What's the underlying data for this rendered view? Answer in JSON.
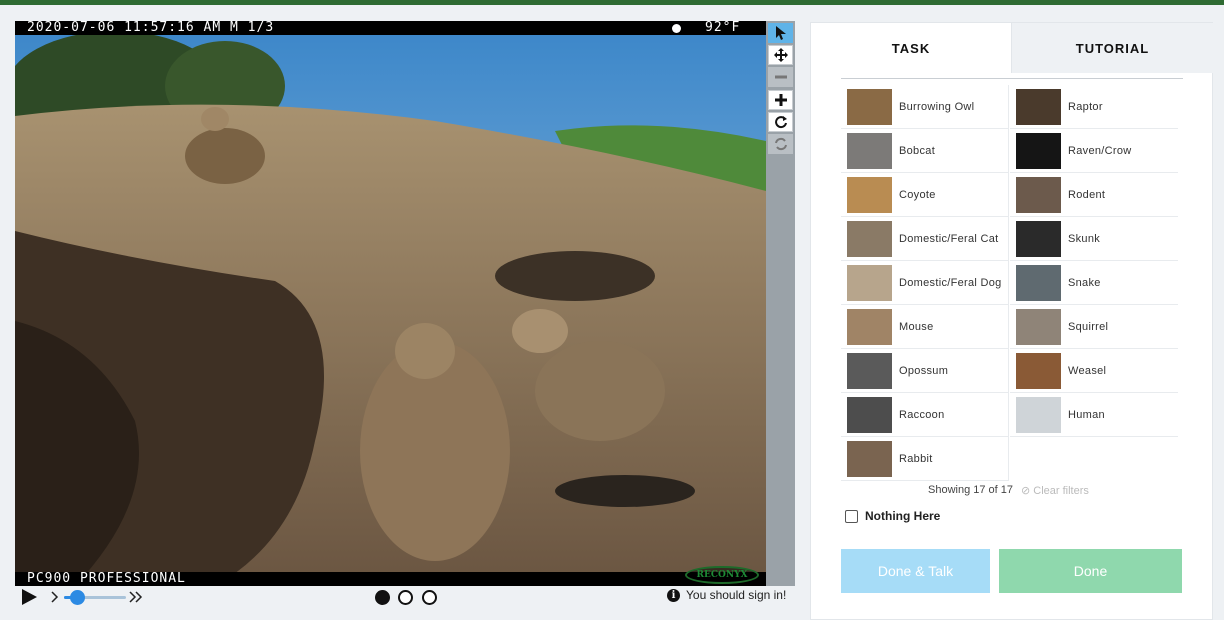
{
  "viewer": {
    "timestamp": "2020-07-06 11:57:16 AM  M 1/3",
    "temperature": "92°F",
    "camera_label": "PC900 PROFESSIONAL",
    "brand": "RECONYX"
  },
  "tools": [
    "pointer-icon",
    "move-icon",
    "zoom-out-icon",
    "zoom-in-icon",
    "rotate-icon",
    "reset-icon"
  ],
  "player": {
    "frames": 3,
    "current_frame": 1,
    "signin_text": "You should sign in!"
  },
  "tabs": {
    "task": "TASK",
    "tutorial": "TUTORIAL"
  },
  "species": [
    {
      "name": "Burrowing Owl",
      "color": "#8a6a45"
    },
    {
      "name": "Raptor",
      "color": "#4a3a2c"
    },
    {
      "name": "Bobcat",
      "color": "#7c7a78"
    },
    {
      "name": "Raven/Crow",
      "color": "#151515"
    },
    {
      "name": "Coyote",
      "color": "#b98c52"
    },
    {
      "name": "Rodent",
      "color": "#6c5a4c"
    },
    {
      "name": "Domestic/Feral Cat",
      "color": "#8a7a66"
    },
    {
      "name": "Skunk",
      "color": "#2a2a2a"
    },
    {
      "name": "Domestic/Feral Dog",
      "color": "#b7a58c"
    },
    {
      "name": "Snake",
      "color": "#5f6a70"
    },
    {
      "name": "Mouse",
      "color": "#a08466"
    },
    {
      "name": "Squirrel",
      "color": "#8f8478"
    },
    {
      "name": "Opossum",
      "color": "#5a5a5a"
    },
    {
      "name": "Weasel",
      "color": "#8a5a36"
    },
    {
      "name": "Raccoon",
      "color": "#4d4d4d"
    },
    {
      "name": "Human",
      "color": "#cfd4d8"
    },
    {
      "name": "Rabbit",
      "color": "#7a6450"
    }
  ],
  "showing": "Showing 17 of 17",
  "clear_filters": "⊘ Clear filters",
  "nothing_here": "Nothing Here",
  "buttons": {
    "done_talk": "Done & Talk",
    "done": "Done"
  }
}
